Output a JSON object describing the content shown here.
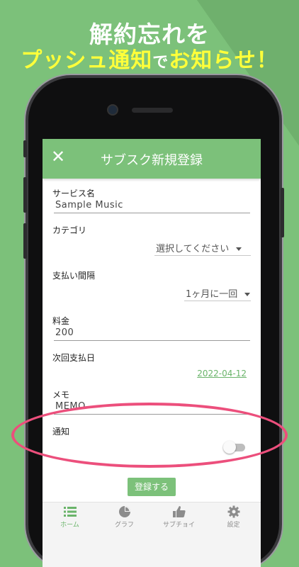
{
  "headline": {
    "line1": "解約忘れを",
    "line2_part1": "プッシュ通知",
    "line2_small": "で",
    "line2_part2": "お知らせ！"
  },
  "app": {
    "title": "サブスク新規登録",
    "close_icon": "close-icon"
  },
  "form": {
    "service_label": "サービス名",
    "service_value": "Sample Music",
    "category_label": "カテゴリ",
    "category_value": "選択してください",
    "interval_label": "支払い間隔",
    "interval_value": "1ヶ月に一回",
    "price_label": "料金",
    "price_value": "200",
    "next_date_label": "次回支払日",
    "next_date_value": "2022-04-12",
    "memo_label": "メモ",
    "memo_value": "MEMO",
    "notify_label": "通知",
    "notify_on": false,
    "submit_label": "登録する"
  },
  "nav": [
    {
      "label": "ホーム",
      "icon": "list-icon",
      "active": true
    },
    {
      "label": "グラフ",
      "icon": "pie-chart-icon",
      "active": false
    },
    {
      "label": "サブチョイ",
      "icon": "thumbs-up-icon",
      "active": false
    },
    {
      "label": "設定",
      "icon": "gear-icon",
      "active": false
    }
  ],
  "colors": {
    "brand_green": "#7cc17a",
    "headline_yellow": "#ffff3a",
    "highlight_pink": "#ec4f7c"
  }
}
